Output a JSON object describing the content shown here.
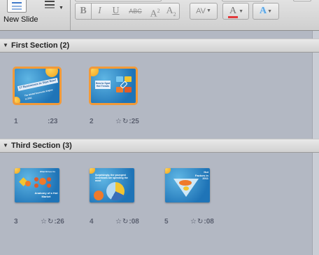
{
  "toolbar": {
    "new_slide_label": "New Slide",
    "buttons": {
      "bold": "B",
      "italic": "I",
      "underline": "U",
      "strikethrough": "ABC",
      "superscript_base": "A",
      "superscript_sup": "2",
      "subscript_base": "A",
      "subscript_sub": "2",
      "char_spacing": "AV",
      "font_color": "A",
      "text_effects": "A"
    },
    "colors": {
      "font_color_underline": "#e2393c",
      "text_effects_color": "#5aa7e6"
    }
  },
  "sections": [
    {
      "title": "First Section (2)",
      "slides": [
        {
          "number": "1",
          "timing": ":23",
          "selected": true,
          "title": "17 Businesses to Start Now!",
          "subtitle": "The Global Economic Engine in 2011"
        },
        {
          "number": "2",
          "timing": ":25",
          "selected": true,
          "title": "How to Spot Hot Trends"
        }
      ]
    },
    {
      "title": "Third Section (3)",
      "slides": [
        {
          "number": "3",
          "timing": ":26",
          "selected": false,
          "title": "Anatomy of a Hot Market",
          "caption": "What Drives Us"
        },
        {
          "number": "4",
          "timing": ":08",
          "selected": false,
          "title": "Surprisingly, the youngest Americans are spending the most"
        },
        {
          "number": "5",
          "timing": ":08",
          "selected": false,
          "title": "Hot Factors in 2011"
        }
      ]
    }
  ],
  "icons": {
    "transition": "star-icon",
    "animation": "rehearse-icon"
  },
  "theme": {
    "selection_outline": "#f29a38",
    "slide_blue": "#1f74b7",
    "background": "#b3b8c3"
  }
}
